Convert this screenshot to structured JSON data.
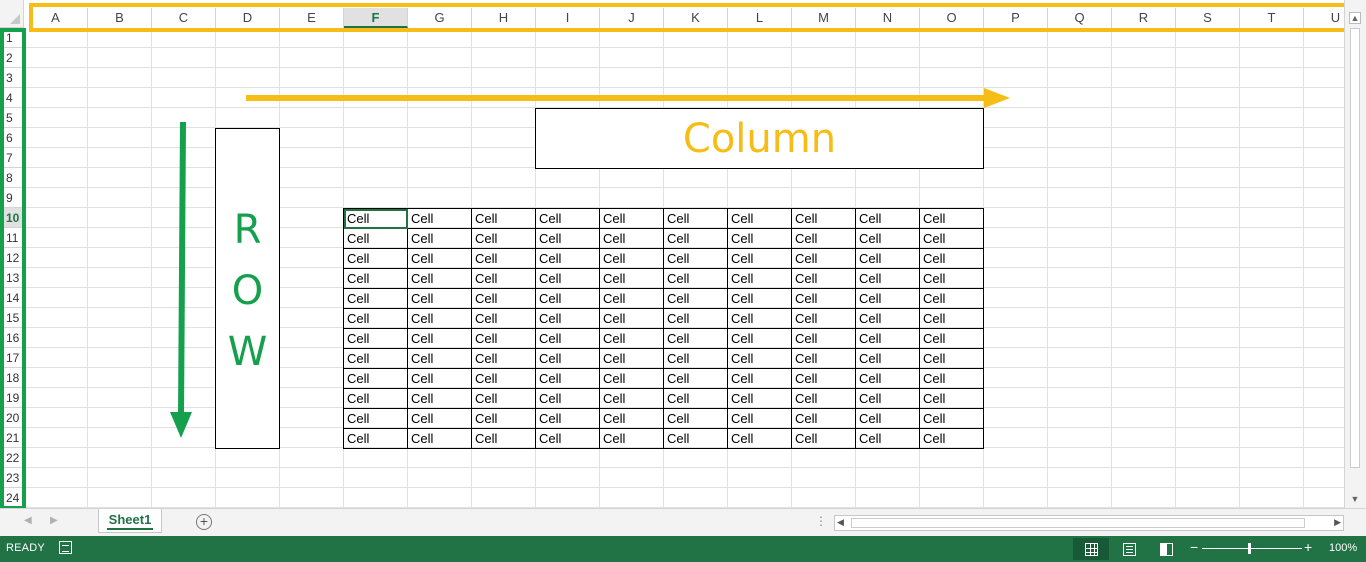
{
  "columns": [
    "A",
    "B",
    "C",
    "D",
    "E",
    "F",
    "G",
    "H",
    "I",
    "J",
    "K",
    "L",
    "M",
    "N",
    "O",
    "P",
    "Q",
    "R",
    "S",
    "T",
    "U"
  ],
  "selected_column": "F",
  "rows": [
    "1",
    "2",
    "3",
    "4",
    "5",
    "6",
    "7",
    "8",
    "9",
    "10",
    "11",
    "12",
    "13",
    "14",
    "15",
    "16",
    "17",
    "18",
    "19",
    "20",
    "21",
    "22",
    "23",
    "24"
  ],
  "selected_row": "10",
  "diagram": {
    "column_label": "Column",
    "row_letters": [
      "R",
      "O",
      "W"
    ]
  },
  "cell_text": "Cell",
  "cell_grid": {
    "rows": 12,
    "cols": 10
  },
  "highlights": {
    "column_header_color": "#f5bd15",
    "row_header_color": "#14a04c"
  },
  "sheet_tabs": [
    "Sheet1"
  ],
  "status": {
    "mode": "READY",
    "zoom": "100%",
    "zoom_minus": "−",
    "zoom_plus": "+",
    "views": [
      "normal-view",
      "page-layout-view",
      "page-break-view"
    ]
  },
  "icons": {
    "add_sheet": "+",
    "scroll_up": "▲",
    "scroll_down": "▼",
    "scroll_left": "◀",
    "scroll_right": "▶",
    "nav_prev": "◀",
    "nav_next": "▶",
    "split": "⋮"
  },
  "accent_color": "#217346"
}
